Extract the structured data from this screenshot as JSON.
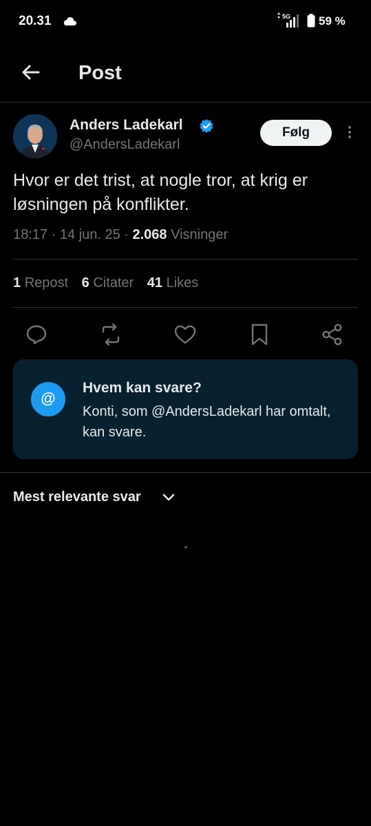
{
  "status_bar": {
    "time": "20.31",
    "network": "5G",
    "battery": "59 %"
  },
  "header": {
    "title": "Post"
  },
  "post": {
    "author_name": "Anders Ladekarl",
    "handle": "@AndersLadekarl",
    "follow_label": "Følg",
    "text": "Hvor er det trist, at nogle tror, at krig er løsningen på konflikter.",
    "time": "18:17",
    "date": "14 jun. 25",
    "views_count": "2.068",
    "views_label": "Visninger",
    "reposts_count": "1",
    "reposts_label": "Repost",
    "quotes_count": "6",
    "quotes_label": "Citater",
    "likes_count": "41",
    "likes_label": "Likes"
  },
  "reply_restriction": {
    "title": "Hvem kan svare?",
    "description": "Konti, som @AndersLadekarl har omtalt, kan svare.",
    "icon_glyph": "@"
  },
  "replies": {
    "sort_label": "Mest relevante svar"
  },
  "colors": {
    "background": "#000000",
    "accent": "#1d9bf0",
    "muted_text": "#71767b",
    "info_box": "#072030"
  },
  "icons": [
    "back-arrow",
    "cloud",
    "signal",
    "battery",
    "verified-badge",
    "more",
    "reply",
    "repost",
    "like",
    "bookmark",
    "share",
    "chevron-down"
  ]
}
